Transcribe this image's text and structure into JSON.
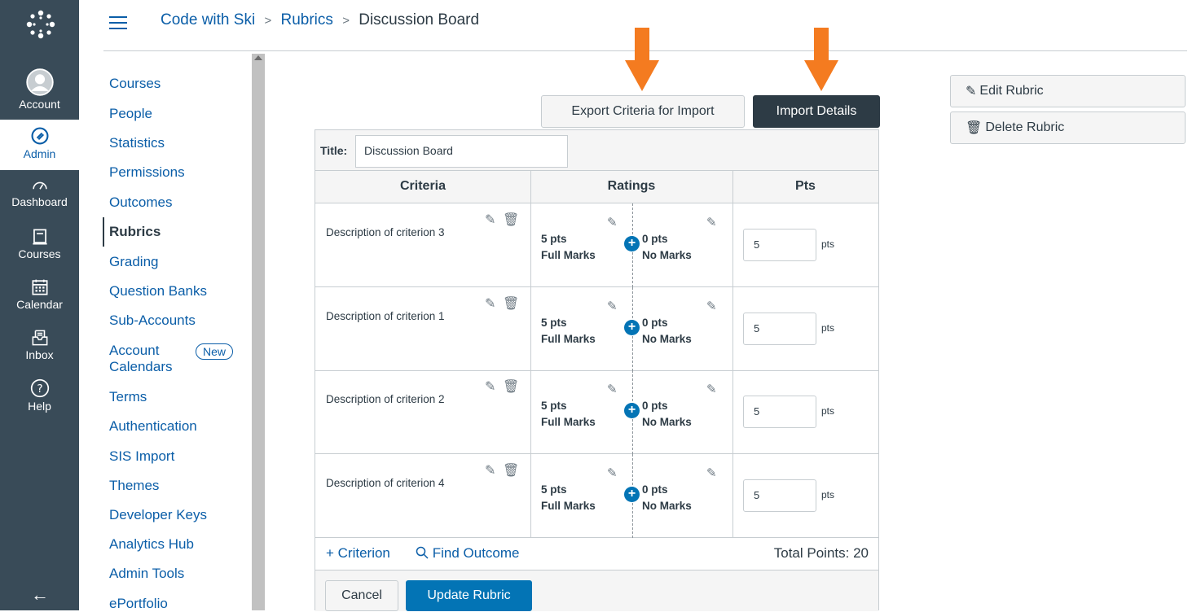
{
  "global_nav": {
    "items": [
      {
        "label": "Account",
        "icon": "account-icon"
      },
      {
        "label": "Admin",
        "icon": "admin-icon"
      },
      {
        "label": "Dashboard",
        "icon": "dashboard-icon"
      },
      {
        "label": "Courses",
        "icon": "courses-icon"
      },
      {
        "label": "Calendar",
        "icon": "calendar-icon"
      },
      {
        "label": "Inbox",
        "icon": "inbox-icon"
      },
      {
        "label": "Help",
        "icon": "help-icon"
      }
    ],
    "collapse_icon": "←"
  },
  "breadcrumb": {
    "items": [
      "Code with Ski",
      "Rubrics"
    ],
    "current": "Discussion Board",
    "separator": ">"
  },
  "subnav": {
    "items": [
      "Courses",
      "People",
      "Statistics",
      "Permissions",
      "Outcomes",
      "Rubrics",
      "Grading",
      "Question Banks",
      "Sub-Accounts",
      "Account",
      "Calendars",
      "Terms",
      "Authentication",
      "SIS Import",
      "Themes",
      "Developer Keys",
      "Analytics Hub",
      "Admin Tools",
      "ePortfolio"
    ],
    "active": "Rubrics",
    "new_badge": "New"
  },
  "toolbar": {
    "export_label": "Export Criteria for Import",
    "import_label": "Import Details",
    "edit_label": "Edit Rubric",
    "delete_label": "Delete Rubric"
  },
  "rubric": {
    "title_label": "Title:",
    "title_value": "Discussion Board",
    "headers": {
      "criteria": "Criteria",
      "ratings": "Ratings",
      "pts": "Pts"
    },
    "rows": [
      {
        "desc": "Description of criterion 3",
        "r1_pts": "5 pts",
        "r1_name": "Full Marks",
        "r2_pts": "0 pts",
        "r2_name": "No Marks",
        "points": "5",
        "pts_label": "pts"
      },
      {
        "desc": "Description of criterion 1",
        "r1_pts": "5 pts",
        "r1_name": "Full Marks",
        "r2_pts": "0 pts",
        "r2_name": "No Marks",
        "points": "5",
        "pts_label": "pts"
      },
      {
        "desc": "Description of criterion 2",
        "r1_pts": "5 pts",
        "r1_name": "Full Marks",
        "r2_pts": "0 pts",
        "r2_name": "No Marks",
        "points": "5",
        "pts_label": "pts"
      },
      {
        "desc": "Description of criterion 4",
        "r1_pts": "5 pts",
        "r1_name": "Full Marks",
        "r2_pts": "0 pts",
        "r2_name": "No Marks",
        "points": "5",
        "pts_label": "pts"
      }
    ],
    "add_criterion": "+ Criterion",
    "find_outcome": "Find Outcome",
    "total_points": "Total Points: 20",
    "cancel_label": "Cancel",
    "update_label": "Update Rubric"
  },
  "colors": {
    "nav_bg": "#394b58",
    "link": "#0b5ea8",
    "primary": "#0374b5",
    "dark_btn": "#2d3b45",
    "arrow": "#f47b20"
  }
}
